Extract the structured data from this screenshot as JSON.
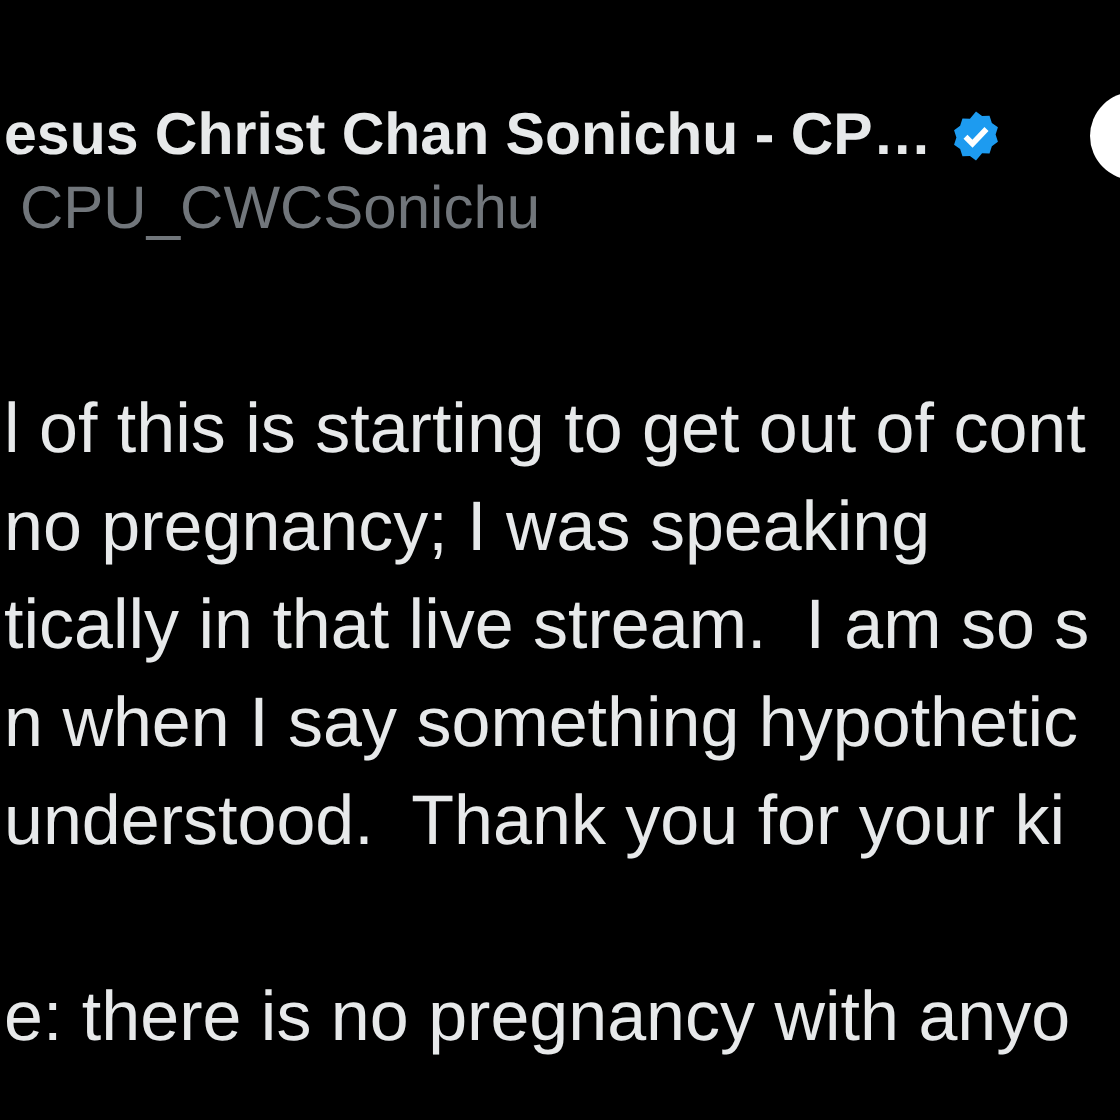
{
  "author": {
    "name": "esus Christ Chan Sonichu - CP…",
    "verified": true,
    "handle": "CPU_CWCSonichu"
  },
  "paragraphs": [
    {
      "lines": [
        "l of this is starting to get out of cont",
        "no pregnancy; I was speaking",
        "tically in that live stream.  I am so s",
        "n when I say something hypothetic",
        "understood.  Thank you for your ki"
      ]
    },
    {
      "lines": [
        "e: there is no pregnancy with anyo"
      ]
    }
  ]
}
